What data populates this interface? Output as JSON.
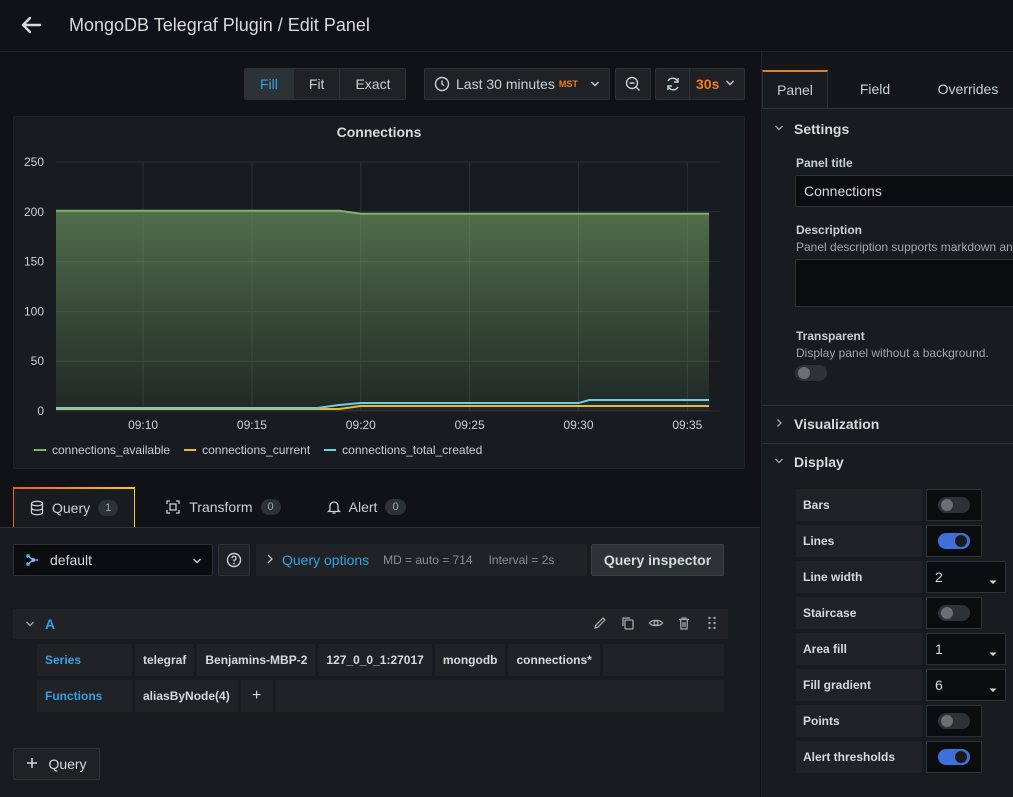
{
  "header": {
    "title": "MongoDB Telegraf Plugin / Edit Panel"
  },
  "toolbar": {
    "fill": "Fill",
    "fit": "Fit",
    "exact": "Exact",
    "time_range": "Last 30 minutes",
    "timezone": "MST",
    "refresh_interval": "30s"
  },
  "panel": {
    "title": "Connections",
    "legend": [
      "connections_available",
      "connections_current",
      "connections_total_created"
    ]
  },
  "chart_data": {
    "type": "line",
    "title": "Connections",
    "x_ticks": [
      "09:10",
      "09:15",
      "09:20",
      "09:25",
      "09:30",
      "09:35"
    ],
    "y_ticks": [
      "0",
      "50",
      "100",
      "150",
      "200",
      "250"
    ],
    "ylim": [
      0,
      250
    ],
    "grid": true,
    "legend_position": "bottom-left",
    "x": [
      "09:06",
      "09:08",
      "09:10",
      "09:12",
      "09:14",
      "09:16",
      "09:18",
      "09:19",
      "09:20",
      "09:22",
      "09:24",
      "09:26",
      "09:28",
      "09:30",
      "09:30.5",
      "09:32",
      "09:34",
      "09:36"
    ],
    "series": [
      {
        "name": "connections_available",
        "color": "#7eb26d",
        "fill": true,
        "values": [
          201,
          201,
          201,
          201,
          201,
          201,
          201,
          201,
          198,
          198,
          198,
          198,
          198,
          198,
          198,
          198,
          198,
          198
        ]
      },
      {
        "name": "connections_current",
        "color": "#eab839",
        "fill": false,
        "values": [
          2,
          2,
          2,
          2,
          2,
          2,
          2,
          2,
          5,
          5,
          5,
          5,
          5,
          5,
          5,
          5,
          5,
          5
        ]
      },
      {
        "name": "connections_total_created",
        "color": "#6ed0e0",
        "fill": false,
        "values": [
          3,
          3,
          3,
          3,
          3,
          3,
          3,
          6,
          8,
          8,
          8,
          8,
          8,
          8,
          11,
          11,
          11,
          11
        ]
      }
    ]
  },
  "query_tabs": [
    {
      "label": "Query",
      "count": "1"
    },
    {
      "label": "Transform",
      "count": "0"
    },
    {
      "label": "Alert",
      "count": "0"
    }
  ],
  "query": {
    "datasource": "default",
    "options_label": "Query options",
    "md": "MD = auto = 714",
    "interval": "Interval = 2s",
    "inspector": "Query inspector",
    "ref_id": "A",
    "series_key": "Series",
    "series": [
      "telegraf",
      "Benjamins-MBP-2",
      "127_0_0_1:27017",
      "mongodb",
      "connections*"
    ],
    "functions_key": "Functions",
    "functions": [
      "aliasByNode(4)"
    ],
    "add_function": "+",
    "add_query": "Query"
  },
  "right_tabs": [
    "Panel",
    "Field",
    "Overrides"
  ],
  "settings": {
    "title": "Settings",
    "panel_title_label": "Panel title",
    "panel_title_value": "Connections",
    "description_label": "Description",
    "description_hint": "Panel description supports markdown and links.",
    "transparent_label": "Transparent",
    "transparent_hint": "Display panel without a background."
  },
  "visualization": {
    "title": "Visualization"
  },
  "display": {
    "title": "Display",
    "rows": [
      {
        "label": "Bars",
        "kind": "switch",
        "on": false
      },
      {
        "label": "Lines",
        "kind": "switch",
        "on": true
      },
      {
        "label": "Line width",
        "kind": "select",
        "value": "2"
      },
      {
        "label": "Staircase",
        "kind": "switch",
        "on": false
      },
      {
        "label": "Area fill",
        "kind": "select",
        "value": "1"
      },
      {
        "label": "Fill gradient",
        "kind": "select",
        "value": "6"
      },
      {
        "label": "Points",
        "kind": "switch",
        "on": false
      },
      {
        "label": "Alert thresholds",
        "kind": "switch",
        "on": true
      }
    ]
  }
}
